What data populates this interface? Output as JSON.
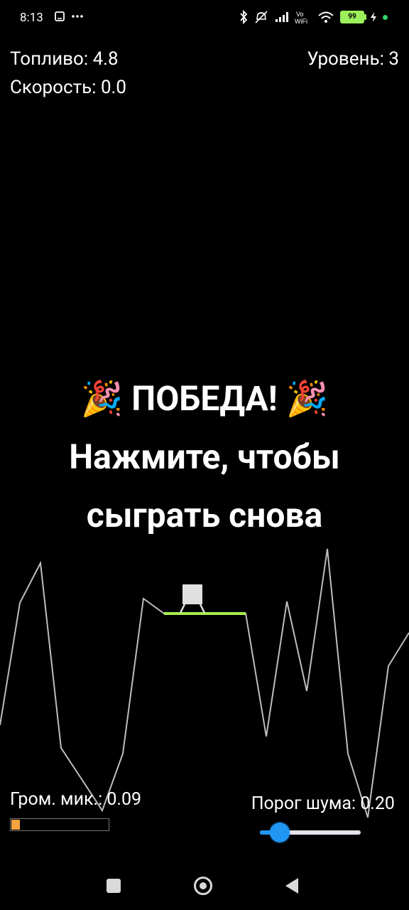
{
  "status_bar": {
    "time": "8:13",
    "battery_level": "99",
    "icons": [
      "screenshot-icon",
      "more-icon",
      "bluetooth-icon",
      "mute-icon",
      "signal-icon",
      "vowifi-icon",
      "wifi-icon",
      "battery-icon",
      "charging-icon"
    ]
  },
  "hud": {
    "fuel": "Топливо: 4.8",
    "speed": "Скорость: 0.0",
    "level": "Уровень: 3"
  },
  "message": {
    "line1": "🎉 ПОБЕДА! 🎉",
    "line2": "Нажмите, чтобы",
    "line3": "сыграть снова"
  },
  "controls": {
    "mic_label": "Гром. мик.: 0.09",
    "mic_level": 0.09,
    "noise_label": "Порог шума: 0.20",
    "noise_threshold": 0.2
  },
  "colors": {
    "terrain": "#bdbdbd",
    "landing_pad": "#a5f04f",
    "lander": "#e0e0e0",
    "mic_fill": "#f4a340",
    "slider": "#2196f3"
  }
}
